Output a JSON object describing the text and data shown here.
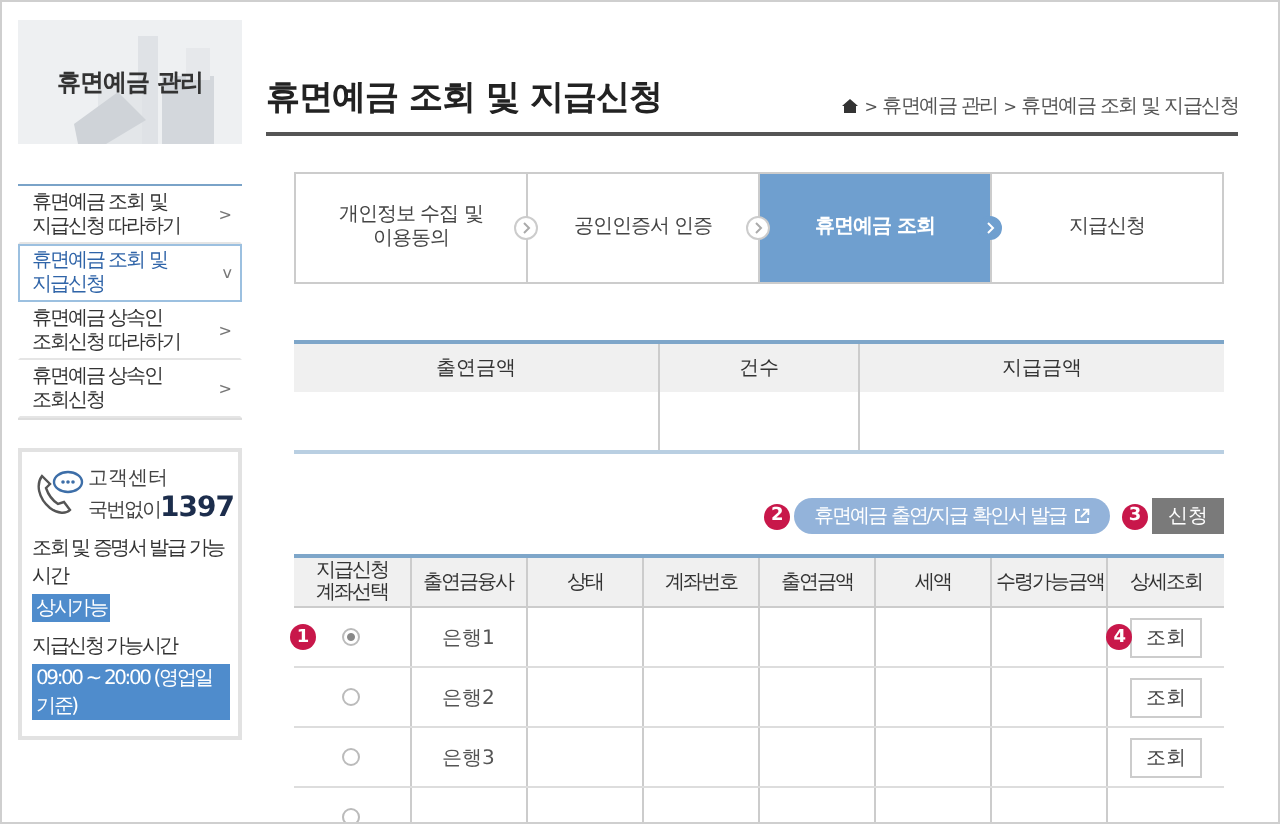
{
  "sidebar": {
    "title": "휴면예금 관리",
    "items": [
      {
        "label": "휴면예금 조회 및\n지급신청 따라하기",
        "chevron": ">",
        "selected": false
      },
      {
        "label": "휴면예금 조회 및\n지급신청",
        "chevron": "v",
        "selected": true
      },
      {
        "label": "휴면예금 상속인\n조회신청 따라하기",
        "chevron": ">",
        "selected": false
      },
      {
        "label": "휴면예금 상속인\n조회신청",
        "chevron": ">",
        "selected": false
      }
    ],
    "customer_center": {
      "label": "고객센터",
      "prefix": "국번없이",
      "number": "1397",
      "hours": [
        {
          "label": "조회 및 증명서 발급 가능시간",
          "value": "상시가능"
        },
        {
          "label": "지급신청 가능시간",
          "value": "09:00 ~ 20:00 (영업일 기준)"
        }
      ]
    }
  },
  "page": {
    "title": "휴면예금 조회 및 지급신청",
    "breadcrumb": {
      "separators": [
        ">",
        ">"
      ],
      "items": [
        "휴면예금 관리",
        "휴면예금 조회 및 지급신청"
      ]
    }
  },
  "steps": [
    {
      "label": "개인정보 수집 및\n이용동의",
      "selected": false
    },
    {
      "label": "공인인증서 인증",
      "selected": false
    },
    {
      "label": "휴면예금 조회",
      "selected": true
    },
    {
      "label": "지급신청",
      "selected": false
    }
  ],
  "summary_table": {
    "columns": [
      "출연금액",
      "건수",
      "지급금액"
    ]
  },
  "actions": {
    "certificate_button": {
      "label": "휴면예금 출연/지급 확인서 발급",
      "marker": "2"
    },
    "apply_button": {
      "label": "신청",
      "marker": "3"
    }
  },
  "accounts_table": {
    "columns": [
      "지급신청\n계좌선택",
      "출연금융사",
      "상태",
      "계좌번호",
      "출연금액",
      "세액",
      "수령가능금액",
      "상세조회"
    ],
    "rows": [
      {
        "selected": true,
        "marker": "1",
        "institution": "은행1",
        "detail_button": "조회",
        "detail_marker": "4"
      },
      {
        "selected": false,
        "institution": "은행2",
        "detail_button": "조회"
      },
      {
        "selected": false,
        "institution": "은행3",
        "detail_button": "조회"
      },
      {
        "selected": false
      }
    ]
  }
}
